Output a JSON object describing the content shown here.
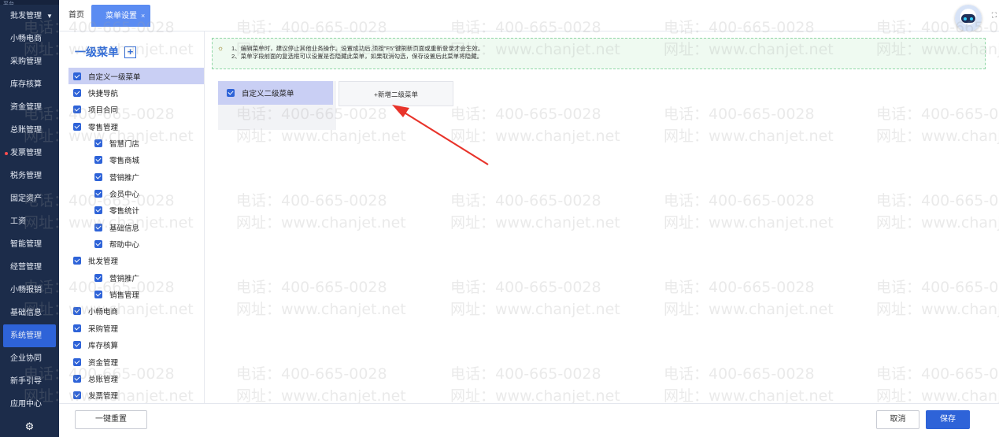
{
  "nav": {
    "top_stub": "平台",
    "items": [
      {
        "label": "批发管理"
      },
      {
        "label": "小畅电商"
      },
      {
        "label": "采购管理"
      },
      {
        "label": "库存核算"
      },
      {
        "label": "资金管理"
      },
      {
        "label": "总账管理"
      },
      {
        "label": "发票管理"
      },
      {
        "label": "税务管理"
      },
      {
        "label": "固定资产"
      },
      {
        "label": "工资"
      },
      {
        "label": "智能管理"
      },
      {
        "label": "经营管理"
      },
      {
        "label": "小畅报销"
      },
      {
        "label": "基础信息"
      },
      {
        "label": "系统管理"
      },
      {
        "label": "企业协同"
      },
      {
        "label": "新手引导"
      },
      {
        "label": "应用中心"
      }
    ]
  },
  "tabs": {
    "home": "首页",
    "menu_settings": "菜单设置",
    "close": "×"
  },
  "left_panel": {
    "title": "一级菜单",
    "add": "+",
    "tree": [
      {
        "label": "自定义一级菜单",
        "level": 1,
        "selected": true
      },
      {
        "label": "快捷导航",
        "level": 1
      },
      {
        "label": "项目合同",
        "level": 1
      },
      {
        "label": "零售管理",
        "level": 1
      },
      {
        "label": "智慧门店",
        "level": 2
      },
      {
        "label": "零售商城",
        "level": 2
      },
      {
        "label": "营销推广",
        "level": 2
      },
      {
        "label": "会员中心",
        "level": 2
      },
      {
        "label": "零售统计",
        "level": 2
      },
      {
        "label": "基础信息",
        "level": 2
      },
      {
        "label": "帮助中心",
        "level": 2
      },
      {
        "label": "批发管理",
        "level": 1
      },
      {
        "label": "营销推广",
        "level": 2
      },
      {
        "label": "销售管理",
        "level": 2
      },
      {
        "label": "小畅电商",
        "level": 1
      },
      {
        "label": "采购管理",
        "level": 1
      },
      {
        "label": "库存核算",
        "level": 1
      },
      {
        "label": "资金管理",
        "level": 1
      },
      {
        "label": "总账管理",
        "level": 1
      },
      {
        "label": "发票管理",
        "level": 1
      }
    ]
  },
  "notice": {
    "line1": "1、编辑菜单时，建议停止其他业务操作。设置成功后,须按\"F5\"键刷新页面或重新登录才会生效。",
    "line2": "2、菜单字段前面的复选框可以设置是否隐藏此菜单，如果取消勾选，保存设置后此菜单将隐藏。"
  },
  "second_level": {
    "item": "自定义二级菜单",
    "add": "+新增二级菜单"
  },
  "watermark": {
    "phone": "电话：400-665-0028",
    "site": "网址：www.chanjet.net"
  },
  "bottom": {
    "reset": "一键重置",
    "cancel": "取消",
    "save": "保存"
  },
  "colors": {
    "accent": "#2e63d8",
    "nav_bg": "#1c2c4a",
    "selected_row": "#c9cff4",
    "notice_border": "#8fd6a5",
    "arrow": "#e8332a"
  }
}
